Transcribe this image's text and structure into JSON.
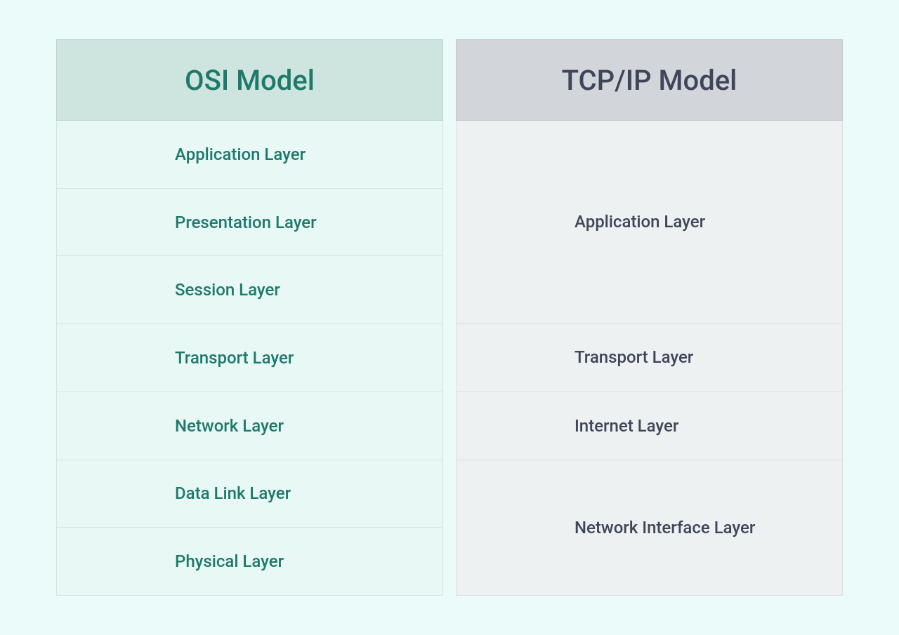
{
  "osi": {
    "title": "OSI Model",
    "layers": [
      "Application Layer",
      "Presentation Layer",
      "Session Layer",
      "Transport Layer",
      "Network Layer",
      "Data Link Layer",
      "Physical Layer"
    ]
  },
  "tcpip": {
    "title": "TCP/IP Model",
    "layers": [
      "Application Layer",
      "Transport Layer",
      "Internet Layer",
      "Network Interface Layer"
    ]
  },
  "colors": {
    "osi_header_bg": "#cde5de",
    "osi_header_text": "#1e796c",
    "osi_layer_bg": "#e7f8f5",
    "osi_layer_text": "#1e796c",
    "tcpip_header_bg": "#d2d6db",
    "tcpip_header_text": "#3f4659",
    "tcpip_layer_bg": "#edf1f2",
    "tcpip_layer_text": "#3f4659",
    "page_bg": "#ebfbf9"
  }
}
